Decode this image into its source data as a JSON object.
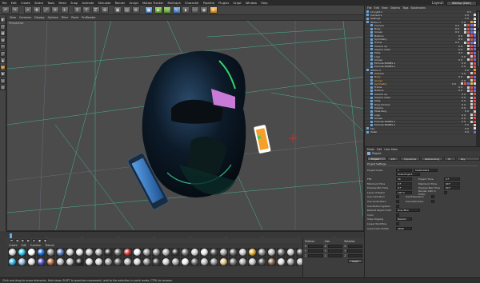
{
  "menubar": {
    "items": [
      "File",
      "Edit",
      "Create",
      "Select",
      "Tools",
      "Mesh",
      "Snap",
      "Animate",
      "Simulate",
      "Render",
      "Sculpt",
      "Motion Tracker",
      "MoGraph",
      "Character",
      "Pipeline",
      "Plugins",
      "Script",
      "Window",
      "Help"
    ],
    "layout_label": "Layout:",
    "layout_value": "Startup (User)"
  },
  "viewport": {
    "menu": [
      "View",
      "Cameras",
      "Display",
      "Options",
      "Filter",
      "Panel",
      "ProRender"
    ],
    "label": "Perspective"
  },
  "materials": {
    "menu": [
      "Create",
      "Edit",
      "Function",
      "Texture"
    ],
    "swatches": [
      "#dcdcdc",
      "#33c8f0",
      "#ffffff",
      "#1a6fd8",
      "#8f8f8f",
      "#5f7fbf",
      "#cfcfcf",
      "#e0e0e0",
      "#c0c0c0",
      "#a8a8a8",
      "#3a3a3a",
      "#6d6d6d",
      "#d23232",
      "#f4f4f4",
      "#9a9a9a",
      "#888888",
      "#b0b0b0",
      "#3c3c3c",
      "#777777",
      "#d0d0d0",
      "#e8e8e8",
      "#5a5a5a",
      "#a0a0a0",
      "#6f6f6f",
      "#c8c8c8",
      "#e6b030",
      "#8e8e8e",
      "#b8b8b8",
      "#7c7c7c",
      "#c4c4c4",
      "#5c5c5c",
      "#33b5e5",
      "#9ab8d8",
      "#e0e0e0",
      "#5050c0",
      "#b46a3a",
      "#bdbdbd",
      "#c0c0c0",
      "#2c2c2c",
      "#e2e2e2",
      "#d5d5d5",
      "#9c9c9c",
      "#6a6a6a",
      "#b5b5b5",
      "#d8d8d8",
      "#8c8c8c",
      "#4f4f4f",
      "#d0d0d0",
      "#a4a4a4",
      "#f0f0f0",
      "#6c6c6c",
      "#bfbfbf",
      "#939393",
      "#e0c08a",
      "#7a7a7a",
      "#ababab",
      "#c6c6c6",
      "#5d5d5d",
      "#8a6a4a",
      "#dedede",
      "#9f9f9f",
      "#b2b2b2"
    ]
  },
  "coords": {
    "headers": [
      "Position",
      "Size",
      "Rotation"
    ],
    "axes": [
      "X",
      "Y",
      "Z"
    ],
    "apply_label": "Apply"
  },
  "statusbar": {
    "text": "Click and drag to move elements. Hold down SHIFT to quantize movement / add to the selection in point mode, CTRL to remove."
  },
  "objects": {
    "menu": [
      "File",
      "Edit",
      "View",
      "Objects",
      "Tags",
      "Bookmarks"
    ],
    "rows": [
      {
        "name": "L0 Light.1",
        "indent": 0,
        "tags": []
      },
      {
        "name": "Camera.1",
        "indent": 0,
        "tags": [
          "#e0e0e0"
        ]
      },
      {
        "name": "Settings",
        "indent": 0,
        "tags": [
          "#e0e0e0"
        ]
      },
      {
        "name": "iPhone 1",
        "indent": 0,
        "tags": [
          "#f0a030",
          "#e0e0e0"
        ]
      },
      {
        "name": "Camera",
        "indent": 1,
        "tags": [
          "#d0d0d0",
          "#e05050",
          "#7070e0",
          "#e0e0e0"
        ]
      },
      {
        "name": "Body",
        "indent": 1,
        "tags": [
          "#d0d0d0",
          "#e05050",
          "#7070e0",
          "#e0e0e0"
        ]
      },
      {
        "name": "Screen",
        "indent": 1,
        "tags": [
          "#d0d0d0",
          "#e05050",
          "#7070e0",
          "#e0e0e0"
        ]
      },
      {
        "name": "Buttons",
        "indent": 1,
        "tags": [
          "#d0d0d0",
          "#e05050",
          "#7070e0"
        ]
      },
      {
        "name": "Symmetry",
        "indent": 1,
        "tags": [
          "#d0d0d0",
          "#e05050",
          "#7070e0"
        ]
      },
      {
        "name": "Frame",
        "indent": 1,
        "tags": [
          "#d0d0d0",
          "#e05050",
          "#7070e0",
          "#e0e0e0"
        ]
      },
      {
        "name": "Volume up",
        "indent": 1,
        "tags": [
          "#d0d0d0",
          "#e05050",
          "#7070e0"
        ]
      },
      {
        "name": "Volume down",
        "indent": 1,
        "tags": [
          "#d0d0d0",
          "#e05050",
          "#7070e0"
        ]
      },
      {
        "name": "Mute",
        "indent": 1,
        "tags": [
          "#d0d0d0",
          "#e05050",
          "#7070e0"
        ]
      },
      {
        "name": "Logo",
        "indent": 1,
        "tags": [
          "#d0d0d0",
          "#e05050"
        ]
      },
      {
        "name": "Screen",
        "indent": 1,
        "tags": [
          "#d0d0d0",
          "#e05050",
          "#7070e0"
        ]
      },
      {
        "name": "Extrude NURBS.1",
        "indent": 1,
        "tags": [
          "#d0d0d0",
          "#e05050"
        ]
      },
      {
        "name": "Extrude NURBS.2",
        "indent": 1,
        "tags": [
          "#d0d0d0",
          "#e05050"
        ]
      },
      {
        "name": "iPhone 2",
        "indent": 0,
        "tags": [
          "#f0a030"
        ]
      },
      {
        "name": "Camera",
        "indent": 1,
        "tags": [
          "#d0d0d0",
          "#e05050"
        ]
      },
      {
        "name": "Body",
        "indent": 1,
        "tags": [
          "#d0d0d0",
          "#e05050",
          "#7070e0"
        ],
        "orange": true
      },
      {
        "name": "Screen",
        "indent": 1,
        "tags": [
          "#d0d0d0",
          "#e05050"
        ],
        "orange": true
      },
      {
        "name": "Symmetry",
        "indent": 1,
        "tags": [
          "#d0d0d0",
          "#e05050",
          "#7070e0",
          "#f0c030",
          "#e0e0e0"
        ],
        "orange": true
      },
      {
        "name": "Frame",
        "indent": 1,
        "tags": [
          "#d0d0d0",
          "#e05050",
          "#7070e0"
        ]
      },
      {
        "name": "Buttons",
        "indent": 1,
        "tags": [
          "#d0d0d0",
          "#e05050",
          "#7070e0"
        ]
      },
      {
        "name": "Volume up",
        "indent": 1,
        "tags": [
          "#d0d0d0",
          "#e05050"
        ]
      },
      {
        "name": "Volume down",
        "indent": 1,
        "tags": [
          "#d0d0d0",
          "#e05050"
        ]
      },
      {
        "name": "Mute",
        "indent": 1,
        "tags": [
          "#d0d0d0",
          "#e05050"
        ]
      },
      {
        "name": "Ring Chrome",
        "indent": 1,
        "tags": [
          "#d0d0d0",
          "#e05050"
        ]
      },
      {
        "name": "Volume",
        "indent": 1,
        "tags": [
          "#d0d0d0",
          "#e05050"
        ]
      },
      {
        "name": "Mute Ring",
        "indent": 1,
        "tags": [
          "#d0d0d0"
        ]
      },
      {
        "name": "Logo",
        "indent": 1,
        "tags": [
          "#d0d0d0",
          "#e05050"
        ]
      },
      {
        "name": "Screen",
        "indent": 1,
        "tags": [
          "#d0d0d0",
          "#e05050"
        ]
      },
      {
        "name": "Extrude NURBS.3",
        "indent": 1,
        "tags": [
          "#d0d0d0",
          "#e05050"
        ]
      },
      {
        "name": "Extrude NURBS.4",
        "indent": 1,
        "tags": [
          "#d0d0d0"
        ]
      },
      {
        "name": "Sky",
        "indent": 0,
        "tags": [
          "#e0e0e0"
        ]
      },
      {
        "name": "Vader",
        "indent": 0,
        "tags": [
          "#7070e0"
        ]
      }
    ]
  },
  "attributes": {
    "menu": [
      "Mode",
      "Edit",
      "User Data"
    ],
    "title": "Project",
    "tabs": [
      "Project Settings",
      "Info",
      "Dynamics",
      "Referencing",
      "To Do",
      "Key Interpolation"
    ],
    "section": "Project Settings",
    "rows": [
      {
        "label": "Project Scale",
        "value": "1",
        "label2": "",
        "value2": "Centimeters"
      },
      {
        "label": "",
        "value": "Scale Project...",
        "label2": "",
        "value2": ""
      },
      {
        "label": "FPS",
        "value": "30",
        "label2": "Project Time",
        "value2": "0 F"
      },
      {
        "label": "Minimum Time",
        "value": "0 F",
        "label2": "Maximum Time",
        "value2": "90 F"
      },
      {
        "label": "Preview Min Time",
        "value": "0 F",
        "label2": "Preview Max Time",
        "value2": "90 F"
      },
      {
        "label": "Level of Detail",
        "value": "100 %",
        "label2": "Render LOD in Editor",
        "value2": ""
      },
      {
        "label": "Use Animation",
        "value": "",
        "label2": "Use Expression",
        "value2": ""
      },
      {
        "label": "Use Generators",
        "value": "",
        "label2": "Use Deformers",
        "value2": ""
      },
      {
        "label": "Use Motion System",
        "value": "",
        "label2": "",
        "value2": ""
      },
      {
        "label": "Default Object Color",
        "value": "Gray Blue",
        "label2": "",
        "value2": ""
      },
      {
        "label": "Color",
        "value": "",
        "label2": "",
        "value2": ""
      },
      {
        "label": "View Clipping",
        "value": "Medium",
        "label2": "",
        "value2": ""
      },
      {
        "label": "Linear Workflow",
        "value": "",
        "label2": "",
        "value2": ""
      },
      {
        "label": "Input Color Profile",
        "value": "sRGB",
        "label2": "",
        "value2": ""
      }
    ]
  }
}
